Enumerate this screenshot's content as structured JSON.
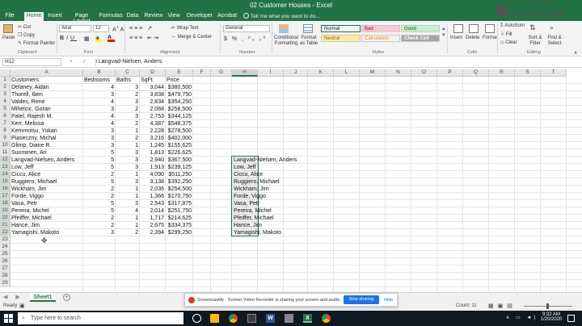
{
  "window": {
    "title": "02 Customer Houses - Excel"
  },
  "ribbon_tabs": [
    {
      "label": "File",
      "active": false
    },
    {
      "label": "Home",
      "active": true
    },
    {
      "label": "Insert",
      "active": false
    },
    {
      "label": "Page Layout",
      "active": false
    },
    {
      "label": "Formulas",
      "active": false
    },
    {
      "label": "Data",
      "active": false
    },
    {
      "label": "Review",
      "active": false
    },
    {
      "label": "View",
      "active": false
    },
    {
      "label": "Developer",
      "active": false
    },
    {
      "label": "Acrobat",
      "active": false
    }
  ],
  "tell_me": "Tell me what you want to do...",
  "ribbon": {
    "paste": "Paste",
    "cut": "Cut",
    "copy": "Copy",
    "format_painter": "Format Painter",
    "font_name": "Arial",
    "font_size": "12",
    "wrap_text": "Wrap Text",
    "merge_center": "Merge & Center",
    "number_format": "General",
    "conditional_formatting": "Conditional Formatting",
    "format_as_table": "Format as Table",
    "styles": [
      {
        "label": "Normal",
        "bg": "#ffffff",
        "fg": "#000000"
      },
      {
        "label": "Bad",
        "bg": "#ffc7ce",
        "fg": "#9c0006"
      },
      {
        "label": "Good",
        "bg": "#c6efce",
        "fg": "#006100"
      },
      {
        "label": "Neutral",
        "bg": "#ffeb9c",
        "fg": "#9c5700"
      },
      {
        "label": "Calculation",
        "bg": "#f2f2f2",
        "fg": "#fa7d00"
      },
      {
        "label": "Check Cell",
        "bg": "#a5a5a5",
        "fg": "#ffffff"
      }
    ],
    "insert": "Insert",
    "delete": "Delete",
    "format": "Format",
    "autosum": "AutoSum",
    "fill": "Fill",
    "clear": "Clear",
    "sort_filter": "Sort & Filter",
    "find_select": "Find & Select",
    "groups": [
      "Clipboard",
      "Font",
      "Alignment",
      "Number",
      "Styles",
      "Cells",
      "Editing"
    ]
  },
  "formula_bar": {
    "name_box": "H12",
    "icons": "× ✓ fx",
    "content": "Langvad-Nielsen, Anders"
  },
  "columns": [
    "A",
    "B",
    "C",
    "D",
    "E",
    "F",
    "G",
    "H",
    "I",
    "J",
    "K",
    "L",
    "M",
    "N",
    "O",
    "P",
    "Q",
    "R",
    "S",
    "T"
  ],
  "row_numbers": [
    "1",
    "2",
    "3",
    "4",
    "5",
    "6",
    "7",
    "8",
    "9",
    "10",
    "11",
    "12",
    "13",
    "14",
    "15",
    "16",
    "17",
    "18",
    "19",
    "20",
    "21",
    "22",
    "23",
    "24",
    "25",
    "26",
    "27",
    "28",
    "29"
  ],
  "headers": {
    "customers": "Customers",
    "bedrooms": "Bedrooms",
    "baths": "Baths",
    "sqft": "SqFt",
    "price": "Price"
  },
  "rows": [
    {
      "customer": "Delaney, Aidan",
      "bedrooms": "4",
      "baths": "3",
      "sqft": "3,044",
      "price": "$380,500"
    },
    {
      "customer": "Thorell, Iben",
      "bedrooms": "3",
      "baths": "2",
      "sqft": "3,838",
      "price": "$479,750"
    },
    {
      "customer": "Valdes, Rene",
      "bedrooms": "4",
      "baths": "3",
      "sqft": "2,834",
      "price": "$354,250"
    },
    {
      "customer": "Mihelcic, Goran",
      "bedrooms": "3",
      "baths": "2",
      "sqft": "2,068",
      "price": "$258,500"
    },
    {
      "customer": "Patel, Rajesh M.",
      "bedrooms": "4",
      "baths": "3",
      "sqft": "2,753",
      "price": "$344,125"
    },
    {
      "customer": "Kerr, Melissa",
      "bedrooms": "4",
      "baths": "2",
      "sqft": "4,387",
      "price": "$548,375"
    },
    {
      "customer": "Kemmotsu, Yukari",
      "bedrooms": "3",
      "baths": "1",
      "sqft": "2,228",
      "price": "$278,500"
    },
    {
      "customer": "Piaseczny, Michal",
      "bedrooms": "3",
      "baths": "2",
      "sqft": "3,216",
      "price": "$402,000"
    },
    {
      "customer": "Glimp, Diane R.",
      "bedrooms": "3",
      "baths": "1",
      "sqft": "1,245",
      "price": "$155,625"
    },
    {
      "customer": "Suominen, Ari",
      "bedrooms": "5",
      "baths": "3",
      "sqft": "1,813",
      "price": "$226,625"
    },
    {
      "customer": "Langvad-Nielsen, Anders",
      "bedrooms": "5",
      "baths": "3",
      "sqft": "2,940",
      "price": "$367,500"
    },
    {
      "customer": "Low, Jeff",
      "bedrooms": "5",
      "baths": "3",
      "sqft": "1,913",
      "price": "$239,125"
    },
    {
      "customer": "Ciccu, Alice",
      "bedrooms": "2",
      "baths": "1",
      "sqft": "4,090",
      "price": "$511,250"
    },
    {
      "customer": "Ruggiero, Michael",
      "bedrooms": "5",
      "baths": "3",
      "sqft": "3,138",
      "price": "$392,250"
    },
    {
      "customer": "Wickham, Jim",
      "bedrooms": "2",
      "baths": "1",
      "sqft": "2,036",
      "price": "$254,500"
    },
    {
      "customer": "Forde, Viggo",
      "bedrooms": "2",
      "baths": "1",
      "sqft": "1,366",
      "price": "$170,750"
    },
    {
      "customer": "Vasa, Petr",
      "bedrooms": "5",
      "baths": "3",
      "sqft": "2,543",
      "price": "$317,875"
    },
    {
      "customer": "Pereira, Michel",
      "bedrooms": "5",
      "baths": "4",
      "sqft": "2,014",
      "price": "$251,750"
    },
    {
      "customer": "Pfeiffer, Michael",
      "bedrooms": "2",
      "baths": "1",
      "sqft": "1,717",
      "price": "$214,625"
    },
    {
      "customer": "Hance, Jim",
      "bedrooms": "2",
      "baths": "1",
      "sqft": "2,675",
      "price": "$334,375"
    },
    {
      "customer": "Yamagishi, Makoto",
      "bedrooms": "3",
      "baths": "2",
      "sqft": "2,394",
      "price": "$299,250"
    }
  ],
  "column_h": [
    "Langvad-Nielsen, Anders",
    "Low, Jeff",
    "Ciccu, Alice",
    "Ruggiero, Michael",
    "Wickham, Jim",
    "Forde, Viggo",
    "Vasa, Petr",
    "Pereira, Michel",
    "Pfeiffer, Michael",
    "Hance, Jim",
    "Yamagishi, Makoto"
  ],
  "sheet_tab": "Sheet1",
  "status": {
    "mode": "Ready",
    "count": "Count: 11"
  },
  "screencastify": {
    "powered_by": "powered by",
    "brand": "Screencastify",
    "share_message": "Screencastify - Screen Video Recorder is sharing your screen and audio.",
    "stop_button": "Stop sharing",
    "hide_button": "Hide"
  },
  "taskbar": {
    "search_placeholder": "Type here to search",
    "time": "9:32 AM",
    "date": "1/20/2020"
  }
}
